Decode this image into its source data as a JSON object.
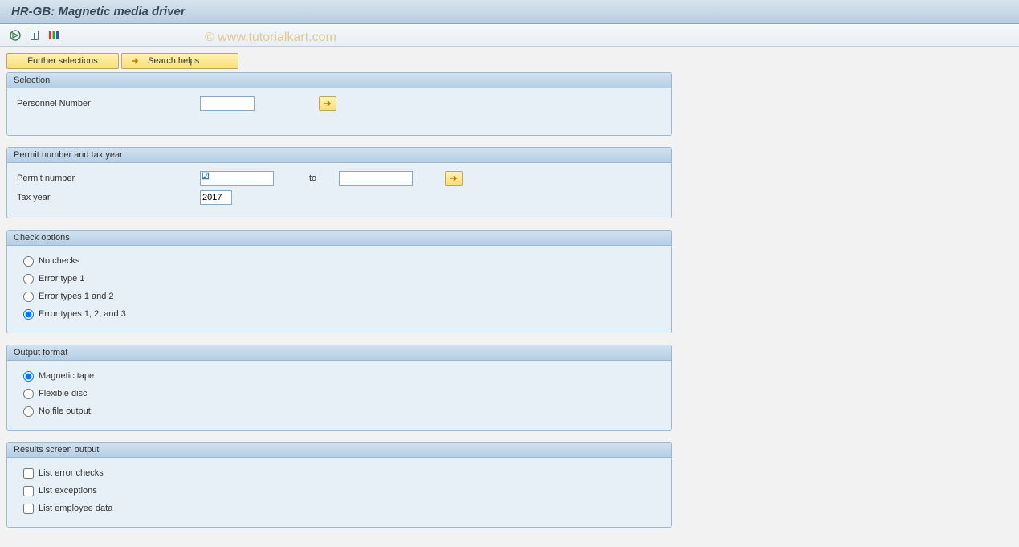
{
  "title": "HR-GB: Magnetic media driver",
  "watermark": "© www.tutorialkart.com",
  "toolbar_buttons": {
    "further_selections": "Further selections",
    "search_helps": "Search helps"
  },
  "groups": {
    "selection": {
      "title": "Selection",
      "personnel_number_label": "Personnel Number",
      "personnel_number_value": ""
    },
    "permit": {
      "title": "Permit number and tax year",
      "permit_number_label": "Permit number",
      "permit_number_from": "",
      "to_label": "to",
      "permit_number_to": "",
      "permit_required_check": true,
      "tax_year_label": "Tax year",
      "tax_year_value": "2017"
    },
    "check_options": {
      "title": "Check options",
      "options": [
        {
          "label": "No checks",
          "selected": false
        },
        {
          "label": "Error type 1",
          "selected": false
        },
        {
          "label": "Error types 1 and 2",
          "selected": false
        },
        {
          "label": "Error types 1, 2, and 3",
          "selected": true
        }
      ]
    },
    "output_format": {
      "title": "Output format",
      "options": [
        {
          "label": "Magnetic tape",
          "selected": true
        },
        {
          "label": "Flexible disc",
          "selected": false
        },
        {
          "label": "No file output",
          "selected": false
        }
      ]
    },
    "results": {
      "title": "Results screen output",
      "options": [
        {
          "label": "List error checks",
          "checked": false
        },
        {
          "label": "List exceptions",
          "checked": false
        },
        {
          "label": "List employee data",
          "checked": false
        }
      ]
    }
  }
}
